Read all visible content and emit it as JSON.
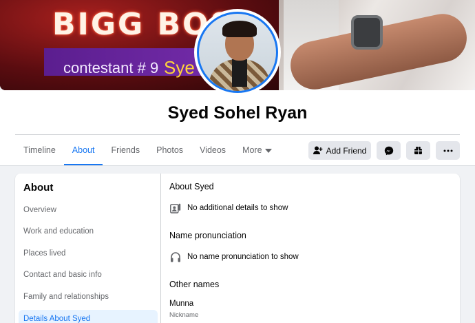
{
  "cover": {
    "title_text": "BIGG BOSS",
    "subtitle_text": "contestant # 9",
    "subtitle_name": "Sye"
  },
  "profile": {
    "name": "Syed Sohel Ryan"
  },
  "tabs": [
    {
      "label": "Timeline",
      "active": false
    },
    {
      "label": "About",
      "active": true
    },
    {
      "label": "Friends",
      "active": false
    },
    {
      "label": "Photos",
      "active": false
    },
    {
      "label": "Videos",
      "active": false
    },
    {
      "label": "More",
      "active": false
    }
  ],
  "actions": {
    "add_friend_label": "Add Friend",
    "icons": [
      "user-plus-icon",
      "messenger-icon",
      "gift-icon",
      "more-icon"
    ]
  },
  "about": {
    "heading": "About",
    "menu": [
      {
        "label": "Overview",
        "active": false
      },
      {
        "label": "Work and education",
        "active": false
      },
      {
        "label": "Places lived",
        "active": false
      },
      {
        "label": "Contact and basic info",
        "active": false
      },
      {
        "label": "Family and relationships",
        "active": false
      },
      {
        "label": "Details About Syed",
        "active": true
      }
    ],
    "sections": {
      "about_syed": {
        "title": "About Syed",
        "text": "No additional details to show",
        "icon": "profile-details-icon"
      },
      "pronunciation": {
        "title": "Name pronunciation",
        "text": "No name pronunciation to show",
        "icon": "headphones-icon"
      },
      "other_names": {
        "title": "Other names",
        "value": "Munna",
        "label": "Nickname"
      }
    }
  },
  "colors": {
    "accent": "#1877f2",
    "background": "#f0f2f5",
    "muted_text": "#65676b"
  }
}
